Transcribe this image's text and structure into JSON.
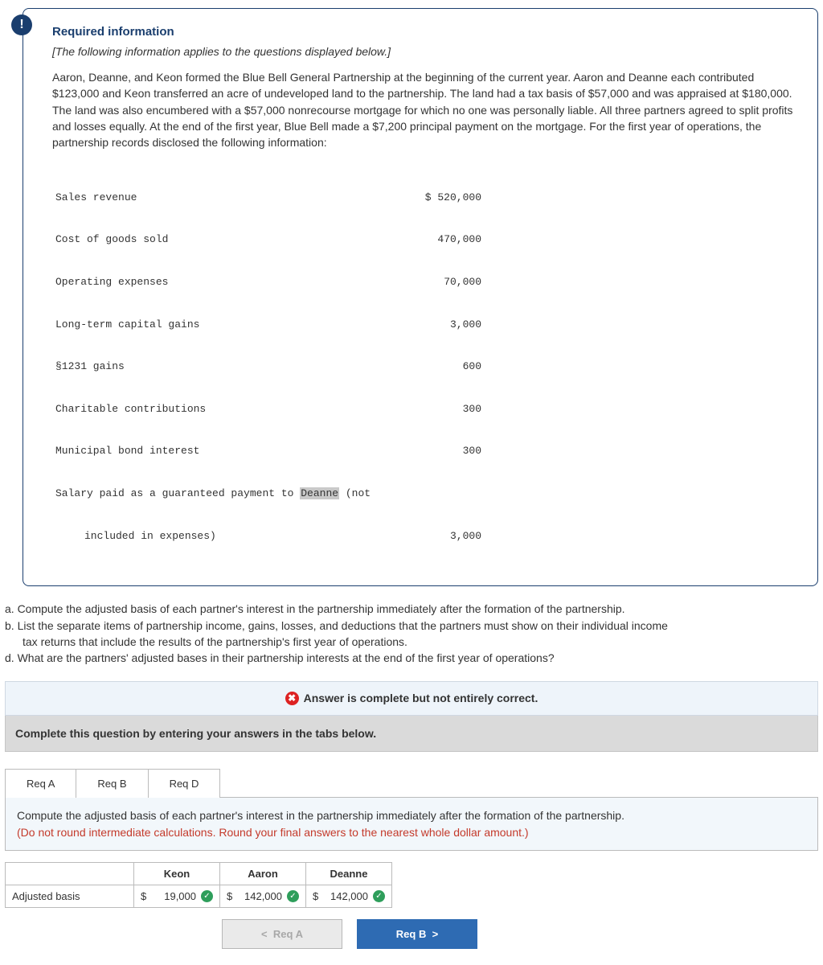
{
  "badge": "!",
  "card": {
    "heading": "Required information",
    "italic_note": "[The following information applies to the questions displayed below.]",
    "body": "Aaron, Deanne, and Keon formed the Blue Bell General Partnership at the beginning of the current year. Aaron and Deanne each contributed $123,000 and Keon transferred an acre of undeveloped land to the partnership. The land had a tax basis of $57,000 and was appraised at $180,000. The land was also encumbered with a $57,000 nonrecourse mortgage for which no one was personally liable. All three partners agreed to split profits and losses equally. At the end of the first year, Blue Bell made a $7,200 principal payment on the mortgage. For the first year of operations, the partnership records disclosed the following information:",
    "rows": [
      {
        "label": "Sales revenue",
        "value": "$ 520,000"
      },
      {
        "label": "Cost of goods sold",
        "value": "470,000"
      },
      {
        "label": "Operating expenses",
        "value": "70,000"
      },
      {
        "label": "Long-term capital gains",
        "value": "3,000"
      },
      {
        "label": "§1231 gains",
        "value": "600"
      },
      {
        "label": "Charitable contributions",
        "value": "300"
      },
      {
        "label": "Municipal bond interest",
        "value": "300"
      }
    ],
    "salary_prefix": "Salary paid as a guaranteed payment to ",
    "salary_highlight": "Deanne",
    "salary_suffix": " (not",
    "salary_line2": "included in expenses)",
    "salary_value": "3,000"
  },
  "questions": {
    "a": "a. Compute the adjusted basis of each partner's interest in the partnership immediately after the formation of the partnership.",
    "b": "b. List the separate items of partnership income, gains, losses, and deductions that the partners must show on their individual income",
    "b2": "tax returns that include the results of the partnership's first year of operations.",
    "d": "d. What are the partners' adjusted bases in their partnership interests at the end of the first year of operations?"
  },
  "status_text": "Answer is complete but not entirely correct.",
  "instruction": "Complete this question by entering your answers in the tabs below.",
  "tabs": {
    "a": "Req A",
    "b": "Req B",
    "d": "Req D"
  },
  "prompt": {
    "main": "Compute the adjusted basis of each partner's interest in the partnership immediately after the formation of the partnership.",
    "note": "(Do not round intermediate calculations. Round your final answers to the nearest whole dollar amount.)"
  },
  "table": {
    "headers": {
      "keon": "Keon",
      "aaron": "Aaron",
      "deanne": "Deanne"
    },
    "row_label": "Adjusted basis",
    "cells": {
      "keon": {
        "cur": "$",
        "num": "19,000"
      },
      "aaron": {
        "cur": "$",
        "num": "142,000"
      },
      "deanne": {
        "cur": "$",
        "num": "142,000"
      }
    }
  },
  "nav": {
    "prev_arrow": "<",
    "prev": "Req A",
    "next": "Req B",
    "next_arrow": ">"
  }
}
